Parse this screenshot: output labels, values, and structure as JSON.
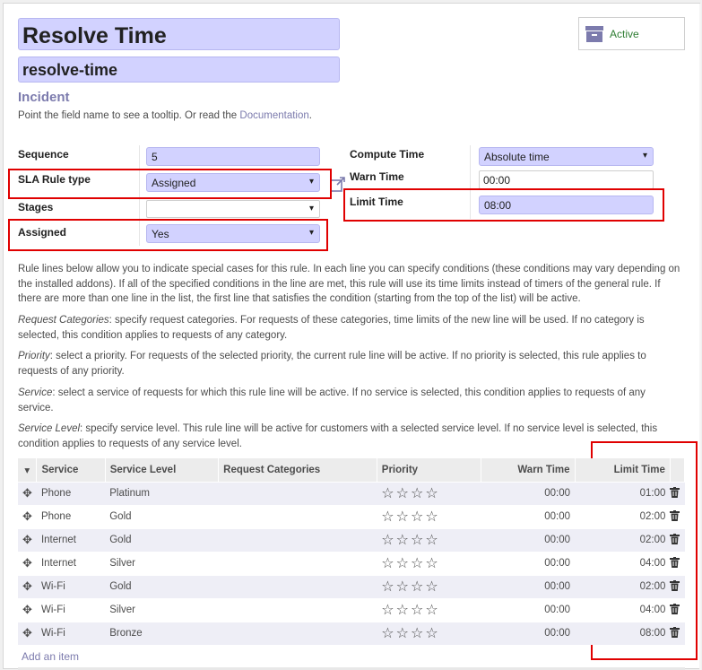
{
  "record": {
    "title": "Resolve Time",
    "code": "resolve-time",
    "subtitle": "Incident",
    "hint_text": "Point the field name to see a tooltip. Or read the ",
    "hint_link": "Documentation",
    "hint_end": "."
  },
  "status_button": {
    "label": "Active",
    "icon": "archive-icon"
  },
  "form": {
    "sequence_label": "Sequence",
    "sequence_value": "5",
    "rule_type_label": "SLA Rule type",
    "rule_type_value": "Assigned",
    "stages_label": "Stages",
    "stages_value": "",
    "assigned_label": "Assigned",
    "assigned_value": "Yes",
    "compute_time_label": "Compute Time",
    "compute_time_value": "Absolute time",
    "warn_time_label": "Warn Time",
    "warn_time_value": "00:00",
    "limit_time_label": "Limit Time",
    "limit_time_value": "08:00"
  },
  "help": {
    "intro": "Rule lines below allow you to indicate special cases for this rule. In each line you can specify conditions (these conditions may vary depending on the installed addons). If all of the specified conditions in the line are met, this rule will use its time limits instead of timers of the general rule. If there are more than one line in the list, the first line that satisfies the condition (starting from the top of the list) will be active.",
    "categories_term": "Request Categories",
    "categories_text": ": specify request categories. For requests of these categories, time limits of the new line will be used. If no category is selected, this condition applies to requests of any category.",
    "priority_term": "Priority",
    "priority_text": ": select a priority. For requests of the selected priority, the current rule line will be active. If no priority is selected, this rule applies to requests of any priority.",
    "service_term": "Service",
    "service_text": ": select a service of requests for which this rule line will be active. If no service is selected, this condition applies to requests of any service.",
    "level_term": "Service Level",
    "level_text": ": specify service level. This rule line will be active for customers with a selected service level. If no service level is selected, this condition applies to requests of any service level."
  },
  "table": {
    "headers": [
      "Service",
      "Service Level",
      "Request Categories",
      "Priority",
      "Warn Time",
      "Limit Time"
    ],
    "rows": [
      {
        "service": "Phone",
        "level": "Platinum",
        "categories": "",
        "priority": "☆☆☆☆",
        "warn": "00:00",
        "limit": "01:00"
      },
      {
        "service": "Phone",
        "level": "Gold",
        "categories": "",
        "priority": "☆☆☆☆",
        "warn": "00:00",
        "limit": "02:00"
      },
      {
        "service": "Internet",
        "level": "Gold",
        "categories": "",
        "priority": "☆☆☆☆",
        "warn": "00:00",
        "limit": "02:00"
      },
      {
        "service": "Internet",
        "level": "Silver",
        "categories": "",
        "priority": "☆☆☆☆",
        "warn": "00:00",
        "limit": "04:00"
      },
      {
        "service": "Wi-Fi",
        "level": "Gold",
        "categories": "",
        "priority": "☆☆☆☆",
        "warn": "00:00",
        "limit": "02:00"
      },
      {
        "service": "Wi-Fi",
        "level": "Silver",
        "categories": "",
        "priority": "☆☆☆☆",
        "warn": "00:00",
        "limit": "04:00"
      },
      {
        "service": "Wi-Fi",
        "level": "Bronze",
        "categories": "",
        "priority": "☆☆☆☆",
        "warn": "00:00",
        "limit": "08:00"
      }
    ],
    "add_item": "Add an item"
  },
  "colors": {
    "accent": "#7c7bad",
    "highlight": "#d2d2ff",
    "annotation": "#e00000",
    "active": "#2e7d32"
  }
}
